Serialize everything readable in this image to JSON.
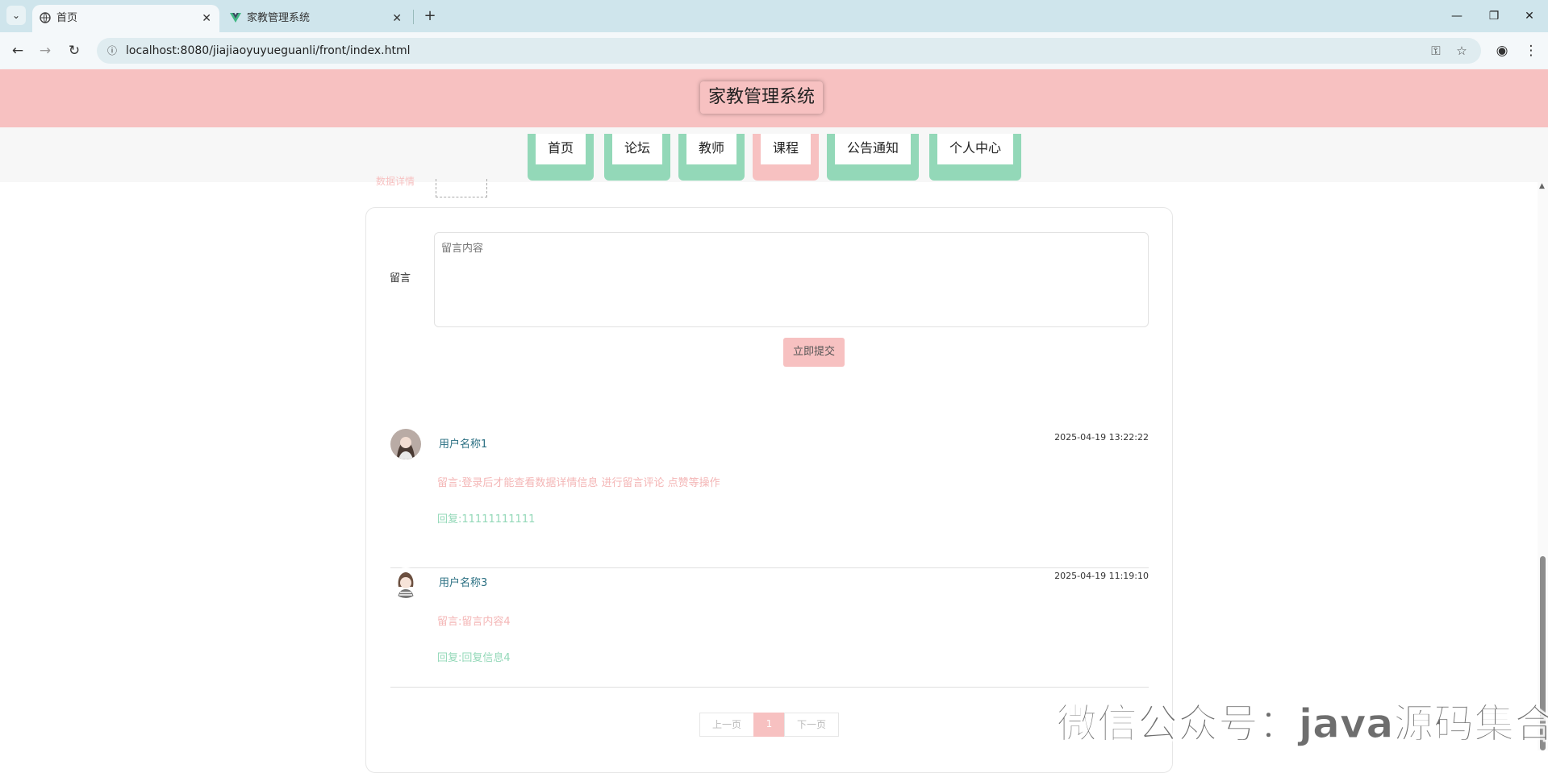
{
  "browser": {
    "tabs": [
      {
        "title": "首页",
        "icon": "globe-icon"
      },
      {
        "title": "家教管理系统",
        "icon": "vue-logo-icon"
      }
    ],
    "url": "localhost:8080/jiajiaoyuyueguanli/front/index.html"
  },
  "site": {
    "title": "家教管理系统",
    "nav": [
      {
        "label": "首页",
        "active": false
      },
      {
        "label": "论坛",
        "active": false
      },
      {
        "label": "教师",
        "active": false
      },
      {
        "label": "课程",
        "active": true
      },
      {
        "label": "公告通知",
        "active": false
      },
      {
        "label": "个人中心",
        "active": false
      }
    ]
  },
  "partial": {
    "label": "数据详情",
    "box": "留言"
  },
  "form": {
    "label": "留言",
    "placeholder": "留言内容",
    "submit": "立即提交"
  },
  "comments": [
    {
      "user": "用户名称1",
      "time": "2025-04-19 13:22:22",
      "text": "留言:登录后才能查看数据详情信息 进行留言评论 点赞等操作",
      "reply": "回复:11111111111"
    },
    {
      "user": "用户名称3",
      "time": "2025-04-19 11:19:10",
      "text": "留言:留言内容4",
      "reply": "回复:回复信息4"
    }
  ],
  "pagination": {
    "prev": "上一页",
    "current": "1",
    "next": "下一页"
  },
  "watermark": "微信公众号：java源码集合",
  "colors": {
    "pink": "#f7c1c1",
    "green": "#93d8b8",
    "username": "#2a6f82"
  }
}
